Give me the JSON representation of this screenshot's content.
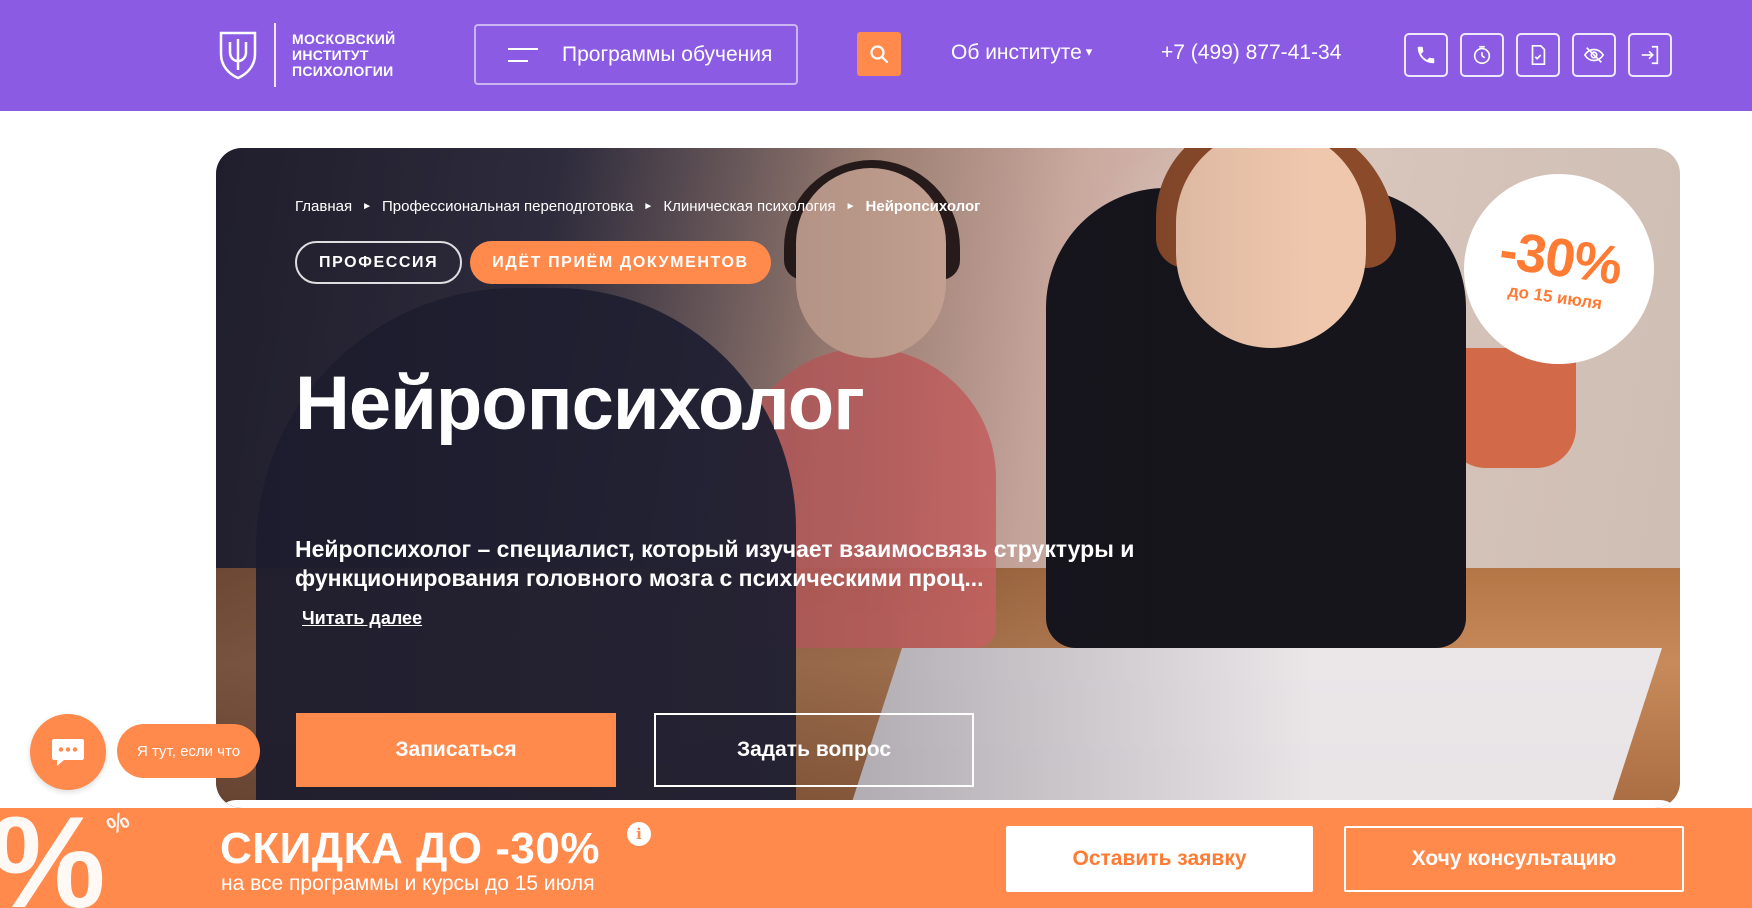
{
  "header": {
    "logo": {
      "line1": "МОСКОВСКИЙ",
      "line2": "ИНСТИТУТ",
      "line3": "ПСИХОЛОГИИ",
      "icon": "psi-shield-icon"
    },
    "programs_label": "Программы обучения",
    "search_icon": "search-icon",
    "about_label": "Об институте",
    "about_caret": "▾",
    "phone": "+7 (499) 877-41-34",
    "icons": [
      "phone-icon",
      "timer-icon",
      "document-icon",
      "eye-off-icon",
      "login-icon"
    ]
  },
  "hero": {
    "breadcrumb": [
      {
        "label": "Главная"
      },
      {
        "label": "Профессиональная переподготовка"
      },
      {
        "label": "Клиническая психология"
      },
      {
        "label": "Нейропсихолог"
      }
    ],
    "breadcrumb_separator": "►",
    "tags": {
      "profession": "ПРОФЕССИЯ",
      "admission": "ИДЁТ ПРИЁМ ДОКУМЕНТОВ"
    },
    "title": "Нейропсихолог",
    "description": "Нейропсихолог – специалист, который изучает взаимосвязь структуры и функционирования головного мозга с психическими проц...",
    "read_more": "Читать далее",
    "enroll_label": "Записаться",
    "ask_label": "Задать вопрос",
    "discount": {
      "value": "-30%",
      "until": "до 15 июля"
    }
  },
  "chat": {
    "icon": "chat-icon",
    "pill_label": "Я тут, если что"
  },
  "promo": {
    "deco": "%",
    "title": "СКИДКА ДО -30%",
    "info": "i",
    "subtitle": "на все программы и курсы до 15 июля",
    "apply_label": "Оставить заявку",
    "consult_label": "Хочу консультацию"
  },
  "colors": {
    "header_bg": "#8b5ce3",
    "accent": "#ff8a4c",
    "white": "#ffffff"
  }
}
